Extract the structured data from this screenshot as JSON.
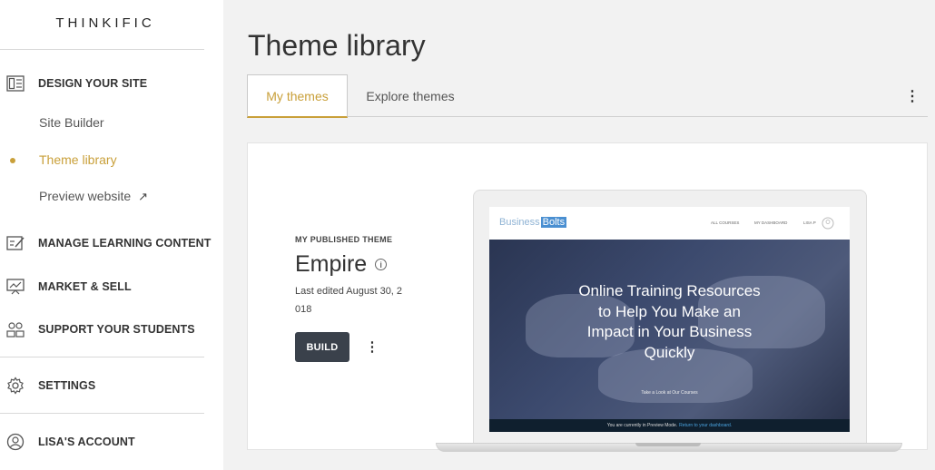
{
  "sidebar": {
    "logo": "THINKIFIC",
    "design": {
      "label": "DESIGN YOUR SITE",
      "items": [
        {
          "label": "Site Builder",
          "active": false
        },
        {
          "label": "Theme library",
          "active": true
        },
        {
          "label": "Preview website",
          "external": true
        }
      ]
    },
    "sections": [
      {
        "label": "MANAGE LEARNING CONTENT",
        "icon": "edit-list-icon"
      },
      {
        "label": "MARKET & SELL",
        "icon": "presentation-chart-icon"
      },
      {
        "label": "SUPPORT YOUR STUDENTS",
        "icon": "students-icon"
      },
      {
        "label": "SETTINGS",
        "icon": "gear-icon"
      },
      {
        "label": "LISA'S ACCOUNT",
        "icon": "user-circle-icon"
      }
    ],
    "external_arrow": "↗",
    "accent_color": "#c9a03a"
  },
  "main": {
    "title": "Theme library",
    "tabs": [
      {
        "label": "My themes",
        "active": true
      },
      {
        "label": "Explore themes",
        "active": false
      }
    ],
    "more_icon": "⋮",
    "card": {
      "published_label": "MY PUBLISHED THEME",
      "theme_name": "Empire",
      "info_icon": "i",
      "last_edited": "Last edited August 30, 2018",
      "build_label": "BUILD",
      "more_icon": "⋮"
    },
    "preview": {
      "logo_part1": "Business",
      "logo_part2": "Bolts",
      "nav": [
        "ALL COURSES",
        "MY DASHBOARD",
        "LISA P"
      ],
      "hero_text": "Online Training Resources to Help You Make an Impact in Your Business Quickly",
      "hero_sub": "Take a Look at Our Courses",
      "bottom_text": "You are currently in Preview Mode.",
      "bottom_link": "Return to your dashboard."
    }
  }
}
